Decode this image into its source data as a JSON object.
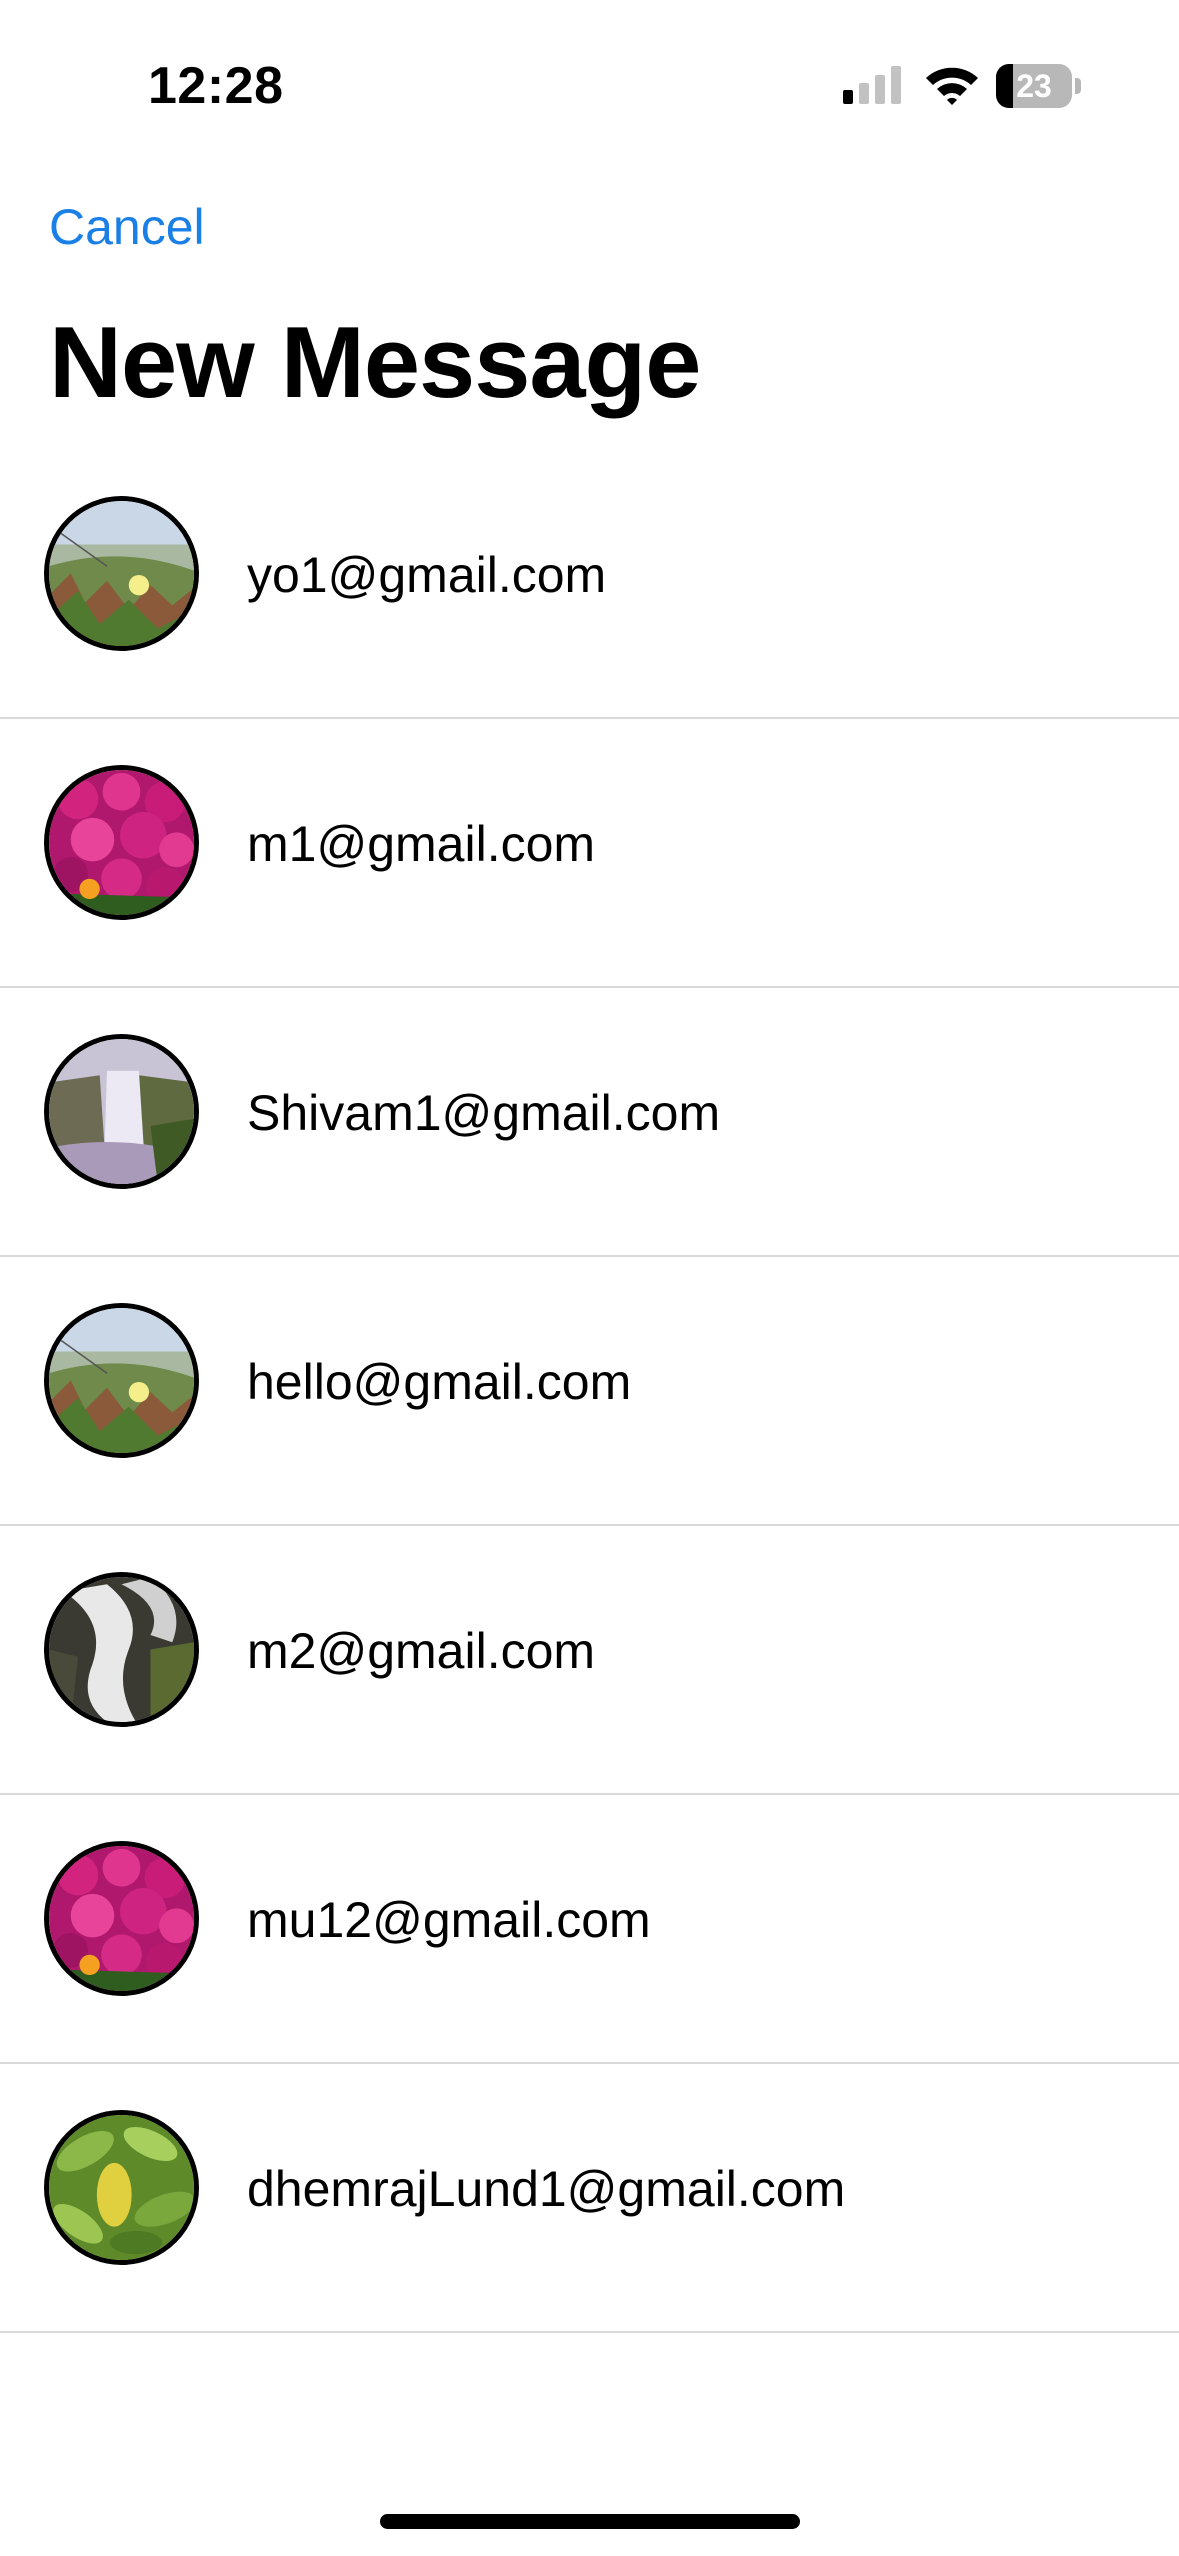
{
  "status_bar": {
    "time": "12:28",
    "battery_level": "23",
    "battery_fraction": 0.23,
    "signal_bars_filled": 1,
    "signal_bars_total": 4
  },
  "nav": {
    "cancel_label": "Cancel",
    "title": "New Message"
  },
  "contacts": [
    {
      "email": "yo1@gmail.com",
      "avatar": "meadow-photo"
    },
    {
      "email": "m1@gmail.com",
      "avatar": "pink-flowers-photo"
    },
    {
      "email": "Shivam1@gmail.com",
      "avatar": "waterfall-photo"
    },
    {
      "email": "hello@gmail.com",
      "avatar": "meadow-photo"
    },
    {
      "email": "m2@gmail.com",
      "avatar": "stream-photo"
    },
    {
      "email": "mu12@gmail.com",
      "avatar": "pink-flowers-photo"
    },
    {
      "email": "dhemrajLund1@gmail.com",
      "avatar": "green-leaves-photo"
    }
  ],
  "colors": {
    "accent": "#1a80e5",
    "divider": "#d9d9d9",
    "text": "#000000"
  }
}
